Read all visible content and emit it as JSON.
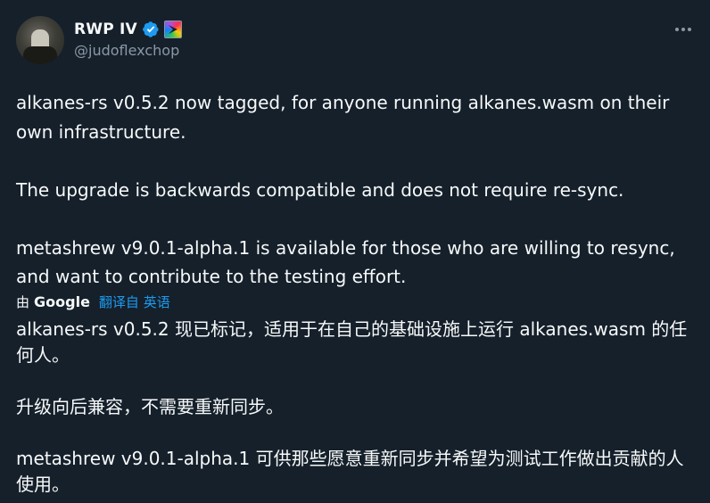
{
  "author": {
    "display_name": "RWP IV",
    "handle": "@judoflexchop",
    "verified": true
  },
  "more_label": "More",
  "tweet": {
    "paragraphs": [
      "alkanes-rs v0.5.2 now tagged, for anyone running alkanes.wasm on their own infrastructure.",
      "The upgrade is backwards compatible and does not require re-sync.",
      "metashrew v9.0.1-alpha.1 is available for those who are willing to resync, and want to contribute to the testing effort."
    ]
  },
  "translation": {
    "by_label": "由",
    "provider": "Google",
    "action_label": "翻译自 英语",
    "paragraphs": [
      "alkanes-rs v0.5.2 现已标记，适用于在自己的基础设施上运行 alkanes.wasm 的任何人。",
      "升级向后兼容，不需要重新同步。",
      "metashrew v9.0.1-alpha.1 可供那些愿意重新同步并希望为测试工作做出贡献的人使用。"
    ]
  },
  "colors": {
    "background": "#15202b",
    "text": "#f7f9f9",
    "secondary": "#8b98a5",
    "accent": "#1d9bf0"
  }
}
